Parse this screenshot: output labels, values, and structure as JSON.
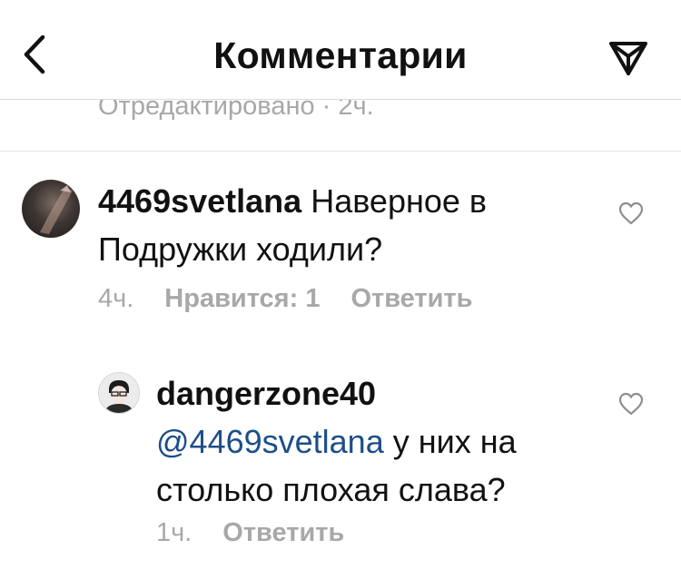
{
  "header": {
    "title": "Комментарии",
    "back_icon": "chevron-left-icon",
    "share_icon": "send-icon"
  },
  "previous_comment": {
    "edited_meta": "Отредактировано · 2ч."
  },
  "comments": [
    {
      "username": "4469svetlana",
      "text": " Наверное в Подружки ходили?",
      "time": "4ч.",
      "likes": "Нравится: 1",
      "reply": "Ответить",
      "avatar_icon": "user-avatar",
      "like_icon": "heart-icon"
    },
    {
      "username": "dangerzone40",
      "mention": "@4469svetlana",
      "text": " у них на столько плохая слава?",
      "time": "1ч.",
      "reply": "Ответить",
      "avatar_icon": "user-avatar",
      "like_icon": "heart-icon"
    }
  ],
  "colors": {
    "text": "#111111",
    "muted": "#a8a8a8",
    "mention": "#1d4e89",
    "divider": "#dbdbdb"
  }
}
